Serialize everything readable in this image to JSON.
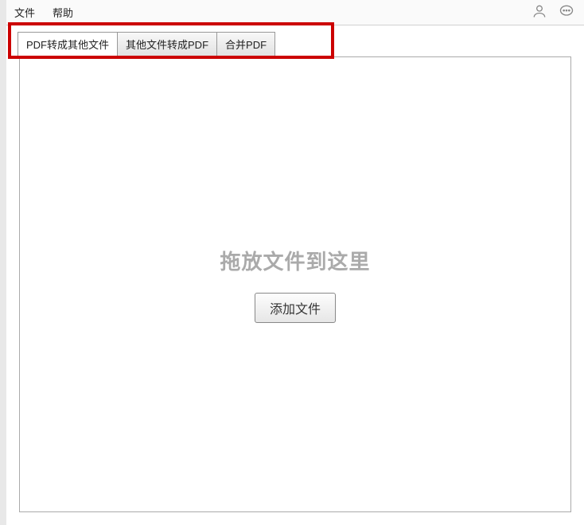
{
  "menubar": {
    "items": [
      {
        "label": "文件"
      },
      {
        "label": "帮助"
      }
    ]
  },
  "titlebar": {
    "user_icon": "user-icon",
    "chat_icon": "chat-icon"
  },
  "tabs": [
    {
      "label": "PDF转成其他文件",
      "active": true
    },
    {
      "label": "其他文件转成PDF",
      "active": false
    },
    {
      "label": "合并PDF",
      "active": false
    }
  ],
  "dropzone": {
    "hint": "拖放文件到这里",
    "add_button_label": "添加文件"
  }
}
